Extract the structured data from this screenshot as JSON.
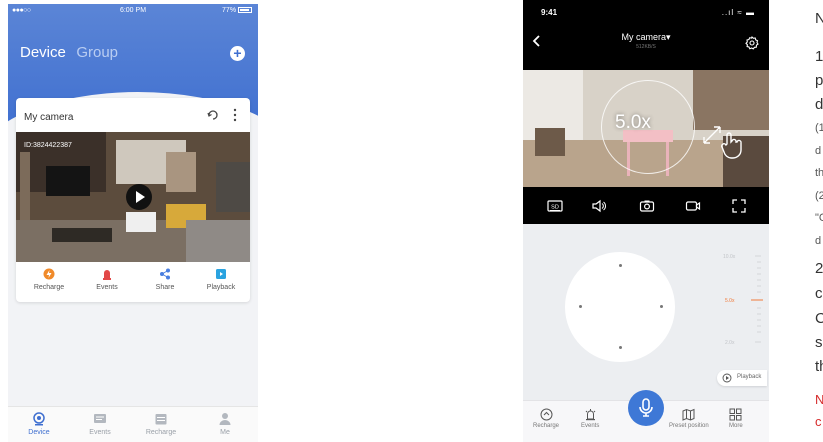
{
  "left_app": {
    "status": {
      "signal": "●●●○○",
      "time": "6:00 PM",
      "battery": "77%"
    },
    "header": {
      "device_tab": "Device",
      "group_tab": "Group",
      "add_symbol": "+"
    },
    "card": {
      "title": "My camera",
      "camera_id": "ID:3824422387",
      "actions": [
        {
          "label": "Recharge",
          "color": "#f08a2a"
        },
        {
          "label": "Events",
          "color": "#e24848"
        },
        {
          "label": "Share",
          "color": "#4a7fe0"
        },
        {
          "label": "Playback",
          "color": "#2aa3e0"
        }
      ]
    },
    "tabbar": [
      {
        "label": "Device",
        "active": true
      },
      {
        "label": "Events",
        "active": false
      },
      {
        "label": "Recharge",
        "active": false
      },
      {
        "label": "Me",
        "active": false
      }
    ]
  },
  "right_app": {
    "status": {
      "time": "9:41",
      "icons": "..ıl ≈ ▬"
    },
    "title": "My camera▾",
    "subtitle": "512KB/S",
    "zoom_overlay": "5.0x",
    "zoom_scale": {
      "top": "10.0x",
      "current": "5.0x",
      "bottom": "2.0x",
      "current_fraction": 0.5
    },
    "playback_label": "Playback",
    "bottombar": [
      {
        "label": "Recharge"
      },
      {
        "label": "Events"
      },
      {
        "label": "Preset position"
      },
      {
        "label": "More"
      }
    ],
    "colors": {
      "accent": "#3e78d6",
      "zoom": "#f07a3a"
    }
  },
  "side_text": {
    "lines": [
      "N",
      "1",
      "p",
      "d",
      "(1",
      "d",
      "th",
      "(2",
      "\"C",
      "d",
      "2",
      "c",
      "C",
      "s",
      "th",
      "N",
      "c"
    ]
  }
}
